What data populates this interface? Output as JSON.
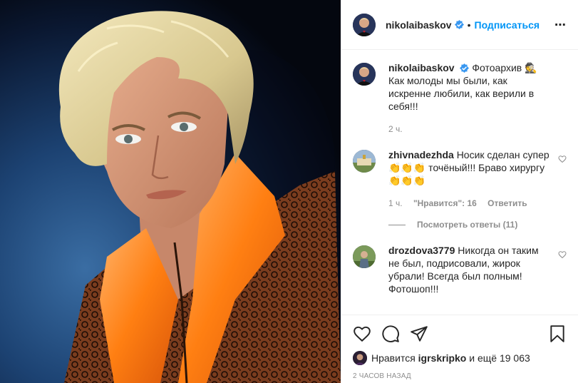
{
  "colors": {
    "accent": "#0095f6",
    "text": "#262626",
    "muted": "#8e8e8e",
    "border": "#efefef",
    "verified": "#3897f0",
    "photo_background": "#1b3d68",
    "shirt": "#ff7d12",
    "hair": "#e2d49a"
  },
  "post": {
    "image_alt": ""
  },
  "header": {
    "username": "nikolaibaskov",
    "separator": "•",
    "follow_label": "Подписаться",
    "more_label": "⋯"
  },
  "caption": {
    "username": "nikolaibaskov",
    "text": "Фотоархив 🕵 Как молоды мы были, как искренне любили, как верили в себя!!!",
    "time": "2 ч."
  },
  "comments": [
    {
      "username": "zhivnadezhda",
      "text": "Носик сделан супер👏👏👏 точёный!!! Браво хирургу👏👏👏",
      "time": "1 ч.",
      "likes": "\"Нравится\": 16",
      "reply": "Ответить",
      "view_replies": "Посмотреть ответы (11)"
    },
    {
      "username": "drozdova3779",
      "text": "Никогда он таким не был, подрисовали, жирок убрали! Всегда был полным! Фотошоп!!!"
    }
  ],
  "actions": {
    "icons": [
      "heart-icon",
      "comment-icon",
      "share-icon",
      "bookmark-icon"
    ],
    "likes_prefix": "Нравится",
    "likes_user": "igrskripko",
    "likes_suffix": "и ещё 19 063",
    "posted": "2 ЧАСОВ НАЗАД"
  }
}
